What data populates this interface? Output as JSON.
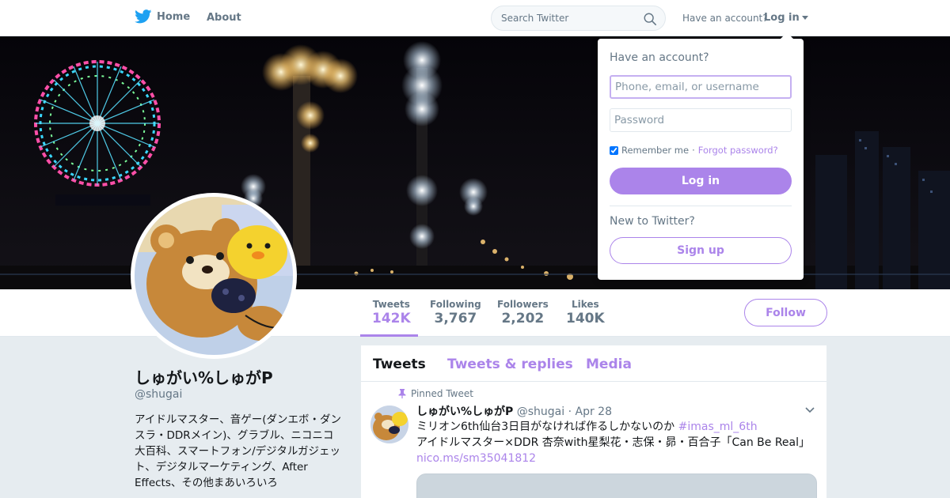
{
  "nav": {
    "home_label": "Home",
    "about_label": "About",
    "search_placeholder": "Search Twitter",
    "have_account": "Have an account?",
    "login_label": "Log in"
  },
  "profile": {
    "name": "しゅがい%しゅがP",
    "handle": "@shugai",
    "bio": "アイドルマスター、音ゲー(ダンエボ・ダンスラ・DDRメイン)、グラブル、ニコニコ大百科、スマートフォン/デジタルガジェット、デジタルマーケティング、After Effects、その他まあいろいろ"
  },
  "stats": [
    {
      "label": "Tweets",
      "value": "142K"
    },
    {
      "label": "Following",
      "value": "3,767"
    },
    {
      "label": "Followers",
      "value": "2,202"
    },
    {
      "label": "Likes",
      "value": "140K"
    }
  ],
  "follow_label": "Follow",
  "timeline": {
    "tabs": [
      "Tweets",
      "Tweets & replies",
      "Media"
    ],
    "pinned_label": "Pinned Tweet",
    "tweet": {
      "name": "しゅがい%しゅがP",
      "handle": "@shugai",
      "date": "· Apr 28",
      "line1": "ミリオン6th仙台3日目がなければ作るしかないのか",
      "hashtag": "#imas_ml_6th",
      "line2": "アイドルマスター×DDR 杏奈with星梨花・志保・昴・百合子「Can Be Real」",
      "link": "nico.ms/sm35041812"
    }
  },
  "login_dropdown": {
    "title": "Have an account?",
    "username_placeholder": "Phone, email, or username",
    "password_placeholder": "Password",
    "remember_label": "Remember me",
    "separator": "·",
    "forgot_label": "Forgot password?",
    "login_button": "Log in",
    "new_label": "New to Twitter?",
    "signup_button": "Sign up"
  },
  "colors": {
    "accent": "#ab84ea",
    "twitter_blue": "#1da1f2",
    "page_bg": "#e6ecf0",
    "muted_text": "#657786"
  }
}
